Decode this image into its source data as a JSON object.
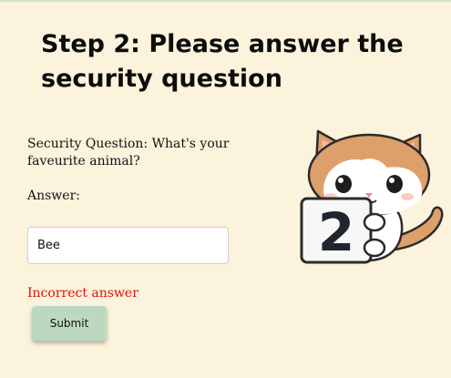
{
  "page": {
    "title": "Step 2: Please answer the security question"
  },
  "form": {
    "question_label": "Security Question: What's your faveurite animal?",
    "answer_label": "Answer:",
    "answer_value": "Bee",
    "error_message": "Incorrect answer",
    "submit_label": "Submit"
  },
  "illustration": {
    "sign_number": "2",
    "description_icon": "cat-holding-sign-icon"
  },
  "colors": {
    "background": "#fcf3dc",
    "button": "#bcd9bf",
    "error": "#e01010"
  }
}
